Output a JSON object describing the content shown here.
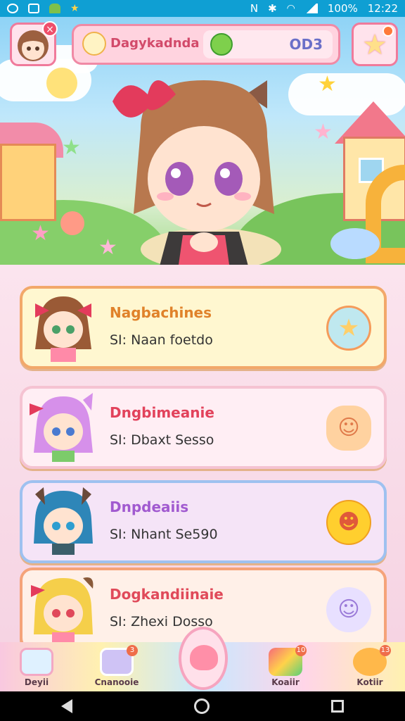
{
  "status_bar": {
    "battery": "100%",
    "time": "12:22"
  },
  "hud": {
    "profile_badge": "×",
    "player_name": "Dagykadnda",
    "currency_value": "OD3"
  },
  "characters": [
    {
      "title": "Nagbachines",
      "subtitle": "SI: Naan foetdo",
      "title_color": "#e0822a",
      "icon": "star-bubble-icon"
    },
    {
      "title": "Dngbimeanie",
      "subtitle": "SI: Dbaxt Sesso",
      "title_color": "#e2425b",
      "icon": "smile-blob-icon"
    },
    {
      "title": "Dnpdeaiis",
      "subtitle": "SI: Nhant Se590",
      "title_color": "#a15ad0",
      "icon": "bear-face-icon"
    },
    {
      "title": "Dogkandiinaie",
      "subtitle": "SI: Zhexi Dosso",
      "title_color": "#e04a5a",
      "icon": "ghost-bunny-icon"
    }
  ],
  "bottom_nav": [
    {
      "label": "Deyii",
      "badge": ""
    },
    {
      "label": "Cnanooie",
      "badge": "3"
    },
    {
      "label": "Koaiir",
      "badge": "10"
    },
    {
      "label": "Kotiir",
      "badge": "13"
    }
  ],
  "colors": {
    "status_bar": "#0f9fd3",
    "accent_pink": "#f07a9b"
  }
}
